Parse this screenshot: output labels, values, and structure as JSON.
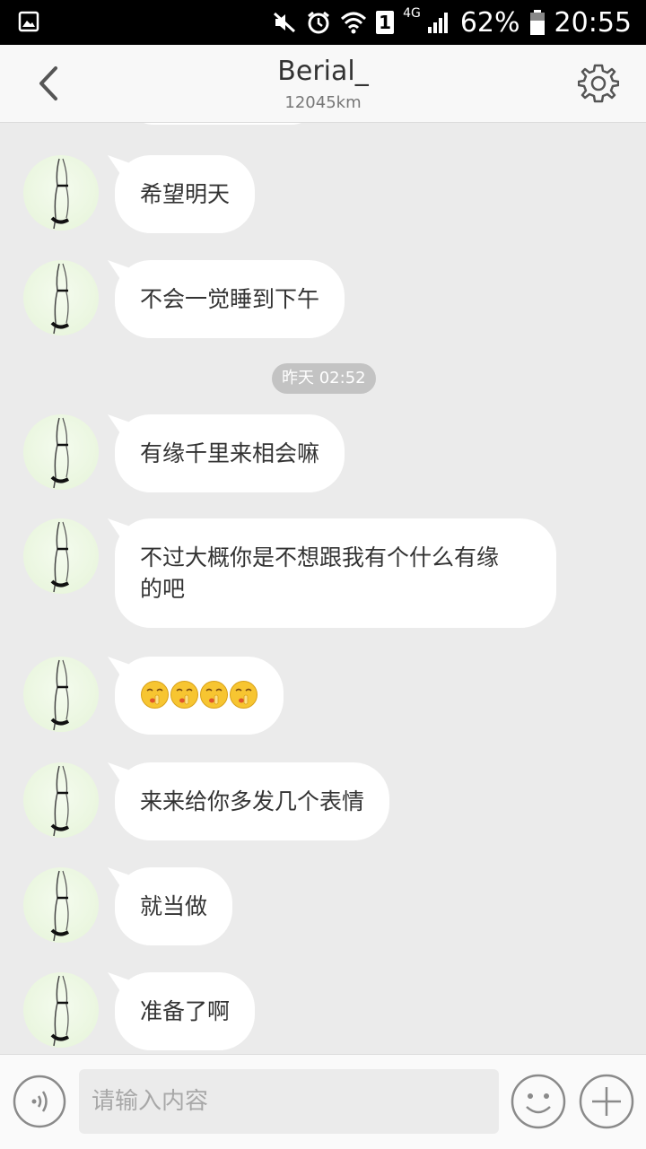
{
  "status_bar": {
    "battery": "62%",
    "time": "20:55",
    "network": "4G",
    "sim": "1"
  },
  "header": {
    "title": "Berial_",
    "distance": "12045km"
  },
  "chat": {
    "timestamp": "昨天 02:52",
    "messages": [
      {
        "text": "希望明天"
      },
      {
        "text": "不会一觉睡到下午"
      },
      {
        "text": "有缘千里来相会嘛"
      },
      {
        "line1": "不过大概你是不想跟我有个什么有缘",
        "line2": "的吧"
      },
      {
        "emoji": "shush-emoji",
        "count": 4
      },
      {
        "text": "来来给你多发几个表情"
      },
      {
        "text": "就当做"
      },
      {
        "text": "准备了啊"
      }
    ]
  },
  "input_bar": {
    "placeholder": "请输入内容"
  },
  "colors": {
    "background": "#ebebeb",
    "bubble": "#ffffff",
    "header": "#f8f8f8",
    "time_pill": "#c3c3c3"
  }
}
